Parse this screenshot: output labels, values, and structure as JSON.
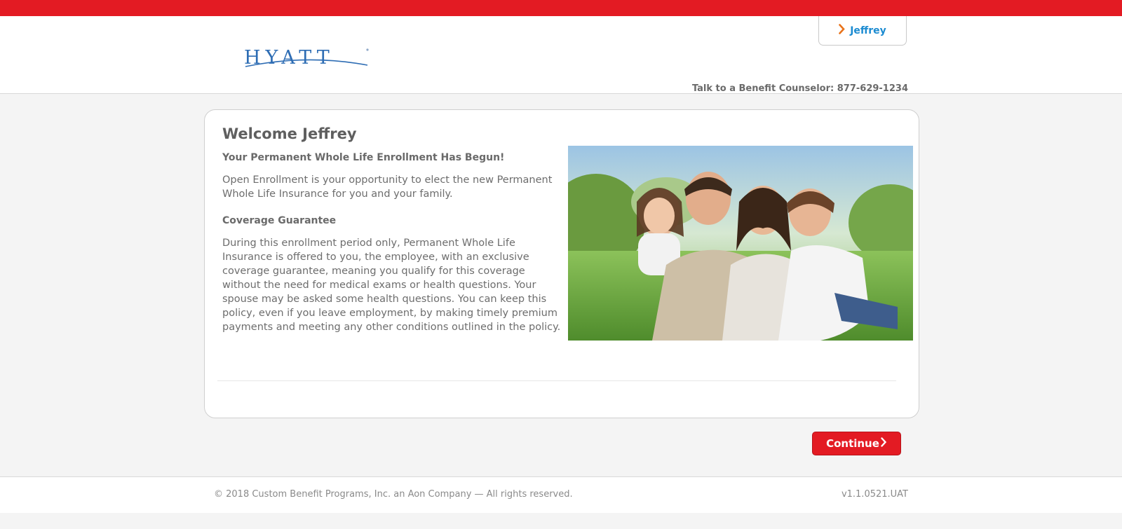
{
  "colors": {
    "brand_red": "#e31b23",
    "link_blue": "#1b8bd1",
    "chevron_orange": "#e8731b",
    "logo_blue": "#2e6db4"
  },
  "header": {
    "logo_text": "HYATT",
    "user_button": {
      "icon": "chevron-right-icon",
      "label": "Jeffrey"
    },
    "counselor_text": "Talk to a Benefit Counselor: 877-629-1234"
  },
  "card": {
    "title": "Welcome Jeffrey",
    "subtitle": "Your Permanent Whole Life Enrollment Has Begun!",
    "intro": "Open Enrollment is your opportunity to elect the new Permanent Whole Life Insurance for you and your family.",
    "section_title": "Coverage Guarantee",
    "body": "During this enrollment period only, Permanent Whole Life Insurance is offered to you, the employee, with an exclusive coverage guarantee, meaning you qualify for this coverage without the need for medical exams or health questions. Your spouse may be asked some health questions. You can keep this policy, even if you leave employment, by making timely premium payments and meeting any other conditions outlined in the policy."
  },
  "actions": {
    "continue_label": "Continue",
    "continue_icon": "chevron-right-icon"
  },
  "footer": {
    "copyright": "© 2018 Custom Benefit Programs, Inc. an Aon Company — All rights reserved.",
    "version": "v1.1.0521.UAT"
  }
}
